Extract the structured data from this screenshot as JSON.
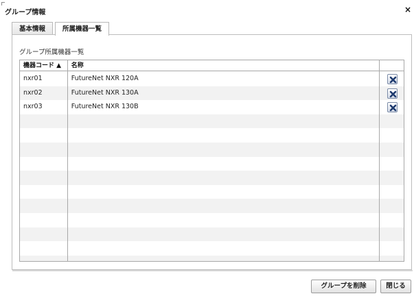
{
  "dialog": {
    "title": "グループ情報",
    "close_symbol": "×"
  },
  "tabs": [
    {
      "label": "基本情報",
      "active": false
    },
    {
      "label": "所属機器一覧",
      "active": true
    }
  ],
  "section_label": "グループ所属機器一覧",
  "table": {
    "headers": [
      "機器コード ▲",
      "名称",
      ""
    ],
    "rows": [
      {
        "code": "nxr01",
        "name": "FutureNet NXR 120A"
      },
      {
        "code": "nxr02",
        "name": "FutureNet NXR 130A"
      },
      {
        "code": "nxr03",
        "name": "FutureNet NXR 130B"
      },
      {
        "code": "",
        "name": ""
      },
      {
        "code": "",
        "name": ""
      },
      {
        "code": "",
        "name": ""
      },
      {
        "code": "",
        "name": ""
      },
      {
        "code": "",
        "name": ""
      },
      {
        "code": "",
        "name": ""
      },
      {
        "code": "",
        "name": ""
      },
      {
        "code": "",
        "name": ""
      },
      {
        "code": "",
        "name": ""
      },
      {
        "code": "",
        "name": ""
      },
      {
        "code": "",
        "name": ""
      }
    ]
  },
  "buttons": {
    "delete_group": "グループを削除",
    "close": "閉じる"
  },
  "icons": {
    "row_delete": "x-delete-icon",
    "dialog_close": "close-icon"
  },
  "colors": {
    "row_alt": "#f2f2f2",
    "border": "#a8a8a8",
    "delete_icon": "#1e3a6e"
  }
}
